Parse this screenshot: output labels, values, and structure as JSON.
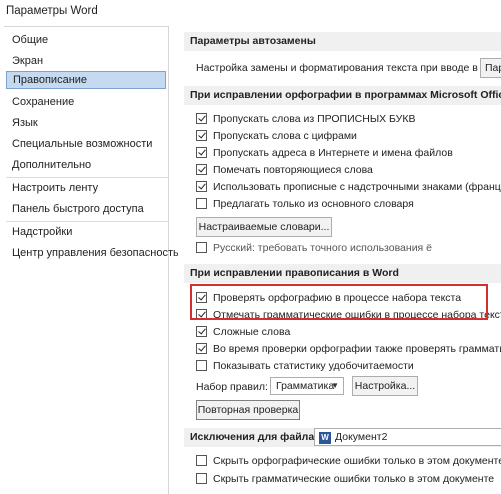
{
  "window": {
    "title": "Параметры Word"
  },
  "sidebar": {
    "items": [
      {
        "label": "Общие"
      },
      {
        "label": "Экран"
      },
      {
        "label": "Правописание"
      },
      {
        "label": "Сохранение"
      },
      {
        "label": "Язык"
      },
      {
        "label": "Специальные возможности"
      },
      {
        "label": "Дополнительно"
      },
      {
        "label": "Настроить ленту"
      },
      {
        "label": "Панель быстрого доступа"
      },
      {
        "label": "Надстройки"
      },
      {
        "label": "Центр управления безопасностью"
      }
    ],
    "active": "Правописание"
  },
  "autocorrect": {
    "header": "Параметры автозамены",
    "description": "Настройка замены и форматирования текста при вводе в Word:",
    "button_label": "Пар"
  },
  "office_spelling": {
    "header": "При исправлении орфографии в программах Microsoft Office",
    "options": [
      {
        "label": "Пропускать слова из ПРОПИСНЫХ БУКВ",
        "checked": true
      },
      {
        "label": "Пропускать слова с цифрами",
        "checked": true
      },
      {
        "label": "Пропускать адреса в Интернете и имена файлов",
        "checked": true
      },
      {
        "label": "Помечать повторяющиеся слова",
        "checked": true
      },
      {
        "label": "Использовать прописные с надстрочными знаками (французский)",
        "checked": true
      },
      {
        "label": "Предлагать только из основного словаря",
        "checked": false
      }
    ],
    "dictionaries_button": "Настраиваемые словари...",
    "russian_option": {
      "label": "Русский: требовать точного использования ё",
      "checked": false
    }
  },
  "word_spelling": {
    "header": "При исправлении правописания в Word",
    "options": [
      {
        "label": "Проверять орфографию в процессе набора текста",
        "checked": true
      },
      {
        "label": "Отмечать грамматические ошибки в процессе набора текста",
        "checked": true
      },
      {
        "label": "Сложные слова",
        "checked": true
      },
      {
        "label": "Во время проверки орфографии также проверять грамматику",
        "checked": true
      },
      {
        "label": "Показывать статистику удобочитаемости",
        "checked": false
      }
    ],
    "rules_label": "Набор правил:",
    "rules_value": "Грамматика",
    "settings_button": "Настройка...",
    "recheck_button": "Повторная проверка"
  },
  "exceptions": {
    "header": "Исключения для файла:",
    "file_name": "Документ2",
    "options": [
      {
        "label": "Скрыть орфографические ошибки только в этом документе",
        "checked": false
      },
      {
        "label": "Скрыть грамматические ошибки только в этом документе",
        "checked": false
      }
    ]
  },
  "colors": {
    "accent": "#d32f2f",
    "selected": "#c5d9f1"
  }
}
